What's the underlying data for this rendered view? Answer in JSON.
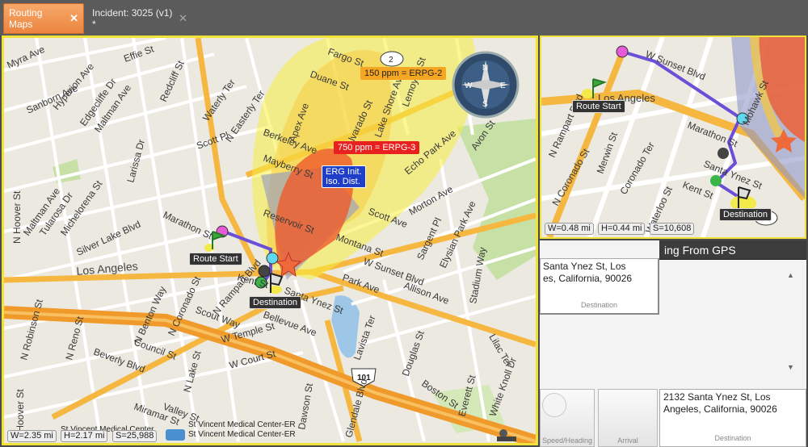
{
  "tabs": [
    {
      "label": "Routing Maps",
      "close": "✕",
      "active": true
    },
    {
      "label": "Incident: 3025 (v1) *",
      "close": "✕",
      "active": false
    }
  ],
  "main_map": {
    "streets": [
      "Myra Ave",
      "Sanborn Ave",
      "Hyperion Ave",
      "Edgecliffe Dr",
      "Maltman Ave",
      "Effie St",
      "Redcliff St",
      "Waterly Ter",
      "N Easterly Ter",
      "Larissa Dr",
      "Scott Pl",
      "Apex Ave",
      "Duane St",
      "Fargo St",
      "Alvarado St",
      "Lake Shore Ave",
      "Lemoyne St",
      "Berkeley Ave",
      "Mayberry St",
      "Echo Park Ave",
      "Avon St",
      "Morton Ave",
      "Maltman Ave",
      "Tularosa Dr",
      "Michelorena St",
      "Silver Lake Blvd",
      "Marathon St",
      "Reservoir St",
      "Scott Ave",
      "Montana St",
      "Sargent Pl",
      "Elysian Park Ave",
      "Stadium Way",
      "N Hoover St",
      "Los Angeles",
      "Kent St",
      "Santa Ynez St",
      "W Sunset Blvd",
      "Park Ave",
      "Allison Ave",
      "N Coronado St",
      "N Benton Way",
      "N Rampart Blvd",
      "Scout Way",
      "Bellevue Ave",
      "N Robinson St",
      "N Reno St",
      "Council St",
      "W Temple St",
      "Lavista Ter",
      "Douglas St",
      "Lilac Ter",
      "Beverly Blvd",
      "N Lake St",
      "W Court St",
      "Boston St",
      "Everett St",
      "White Knoll Dr",
      "Miramar St",
      "Valley St",
      "Dawson St",
      "Glendale Blvd",
      "S Hoover St"
    ],
    "labels": {
      "erpg2": "150 ppm = ERPG-2",
      "erpg3": "750 ppm = ERPG-3",
      "erg_line1": "ERG Init.",
      "erg_line2": "Iso. Dist.",
      "route_start": "Route Start",
      "destination": "Destination",
      "hwy": "101",
      "circle": "2",
      "poi1": "St Vincent Medical Center",
      "poi2": "St Vincent Medical Center-ER",
      "poi3": "St Vincent Medical Center-ER"
    },
    "scale": {
      "w": "W=2.35 mi",
      "h": "H=2.17 mi",
      "s": "S=25,988"
    },
    "compass": {
      "n": "N",
      "s": "S",
      "e": "E",
      "w": "W"
    }
  },
  "mini_map": {
    "streets": [
      "W Sunset Blvd",
      "Los Angeles",
      "N Rampart Blvd",
      "Marathon St",
      "N Coronado St",
      "Merwin St",
      "Coronado Ter",
      "Waterloo St",
      "Santa Ynez St",
      "Kent St",
      "Mohawk St"
    ],
    "labels": {
      "route_start": "Route Start",
      "destination": "Destination",
      "circle": "2"
    },
    "scale": {
      "w": "W=0.48 mi",
      "h": "H=0.44 mi",
      "s": "S=10,608"
    }
  },
  "panel": {
    "header": "ing From GPS",
    "card1": {
      "line1": "Santa Ynez St, Los",
      "line2": "es, California, 90026",
      "label": "Destination"
    },
    "card2": {
      "line1": "2132 Santa Ynez St, Los",
      "line2": "Angeles, California, 90026",
      "label": "Destination"
    },
    "buttons": [
      {
        "label": "Speed/Heading"
      },
      {
        "label": "Arrival"
      }
    ],
    "scroll_up": "▲",
    "scroll_down": "▼"
  }
}
